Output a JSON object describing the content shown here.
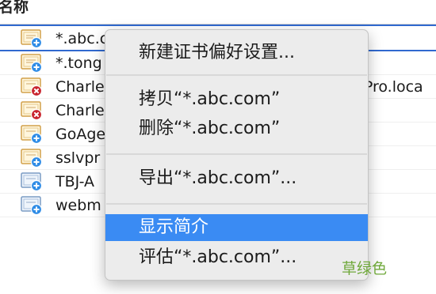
{
  "header": {
    "column_name": "名称"
  },
  "certificates": [
    {
      "name": "*.abc.c",
      "tail": "",
      "status": "plus"
    },
    {
      "name": "*.tong",
      "tail": "",
      "status": "plus"
    },
    {
      "name": "Charle",
      "tail": "-Pro.loca",
      "status": "error"
    },
    {
      "name": "Charle",
      "tail": "",
      "status": "error"
    },
    {
      "name": "GoAge",
      "tail": "",
      "status": "plus"
    },
    {
      "name": "sslvpr",
      "tail": "",
      "status": "plus"
    },
    {
      "name": "TBJ-A",
      "tail": "",
      "status": "plus"
    },
    {
      "name": "webm",
      "tail": "",
      "status": "plus"
    }
  ],
  "context_menu": {
    "new_cert_prefs": "新建证书偏好设置...",
    "copy": "拷贝“*.abc.com”",
    "delete": "删除“*.abc.com”",
    "export": "导出“*.abc.com”...",
    "get_info": "显示简介",
    "evaluate": "评估“*.abc.com”..."
  },
  "watermark": "草绿色",
  "colors": {
    "selection_border": "#3069cf",
    "menu_highlight": "#3a8bf3",
    "error_badge": "#c8232c",
    "plus_badge": "#2f8ce6",
    "watermark": "#6fa83a"
  }
}
